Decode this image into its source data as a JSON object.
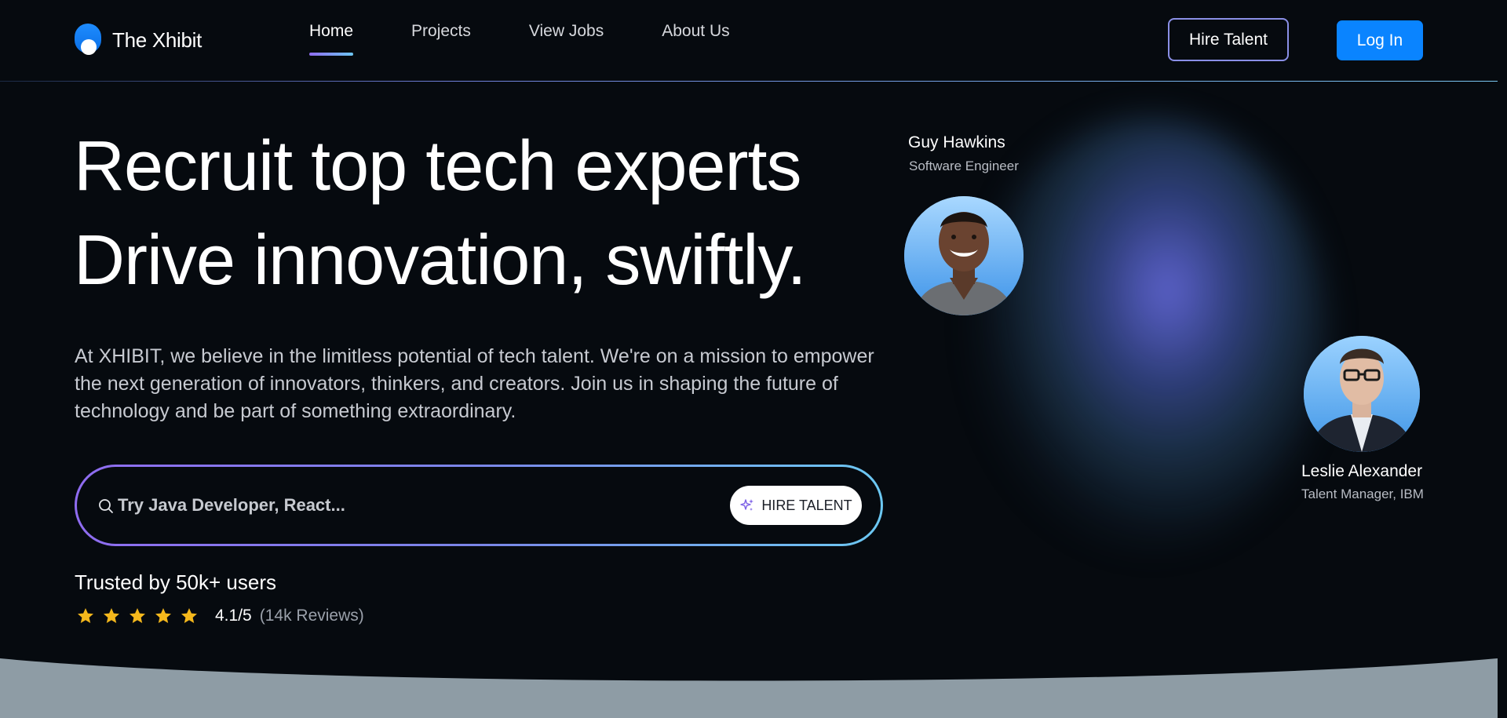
{
  "brand": {
    "name": "The Xhibit"
  },
  "nav": {
    "links": [
      {
        "label": "Home",
        "active": true
      },
      {
        "label": "Projects",
        "active": false
      },
      {
        "label": "View Jobs",
        "active": false
      },
      {
        "label": "About Us",
        "active": false
      }
    ],
    "hire_label": "Hire Talent",
    "login_label": "Log In"
  },
  "hero": {
    "headline_line1": "Recruit top tech experts",
    "headline_line2": "Drive innovation, swiftly.",
    "intro": "At XHIBIT, we believe in the limitless potential of tech talent. We're on a mission to empower the next generation of innovators, thinkers, and creators. Join us in shaping the future of technology and be part of something extraordinary."
  },
  "search": {
    "placeholder": "Try Java Developer, React...",
    "value": "",
    "button_label": "HIRE TALENT"
  },
  "trust": {
    "title": "Trusted by 50k+ users",
    "stars": 5,
    "score": "4.1/5",
    "reviews": "(14k Reviews)"
  },
  "people": [
    {
      "name": "Guy Hawkins",
      "role": "Software Engineer"
    },
    {
      "name": "Leslie Alexander",
      "role": "Talent Manager, IBM"
    }
  ],
  "colors": {
    "background": "#060a0f",
    "accent_blue": "#0a84ff",
    "gradient_start": "#8f6cf0",
    "gradient_end": "#6cc6f2",
    "star": "#f5b81c",
    "footer_band": "#8e9ca5"
  },
  "icons": [
    "search-icon",
    "sparkle-icon",
    "star-icon"
  ]
}
